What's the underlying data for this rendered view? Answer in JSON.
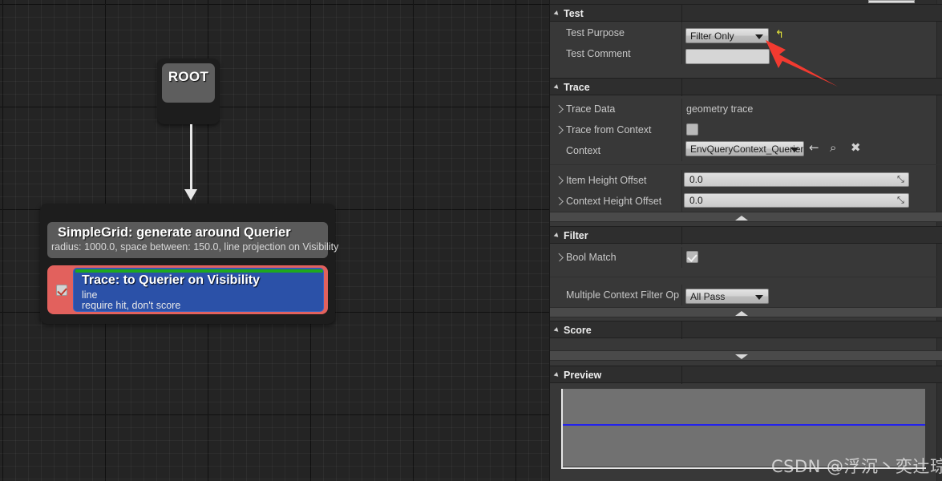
{
  "graph": {
    "root_node": {
      "label": "ROOT"
    },
    "generator_node": {
      "title": "SimpleGrid: generate around Querier",
      "subtitle": "radius: 1000.0, space between: 150.0, line projection on Visibility"
    },
    "test_node": {
      "title": "Trace: to Querier on Visibility",
      "line1": "line",
      "line2": "require hit, don't score",
      "enabled": true
    }
  },
  "details": {
    "sections": {
      "test": {
        "title": "Test",
        "rows": {
          "test_purpose": {
            "label": "Test Purpose",
            "value": "Filter Only"
          },
          "test_comment": {
            "label": "Test Comment",
            "value": ""
          }
        },
        "revert_icon": "↰"
      },
      "trace": {
        "title": "Trace",
        "rows": {
          "trace_data": {
            "label": "Trace Data",
            "value": "geometry trace"
          },
          "trace_from_context": {
            "label": "Trace from Context",
            "checked": false
          },
          "context": {
            "label": "Context",
            "value": "EnvQueryContext_Querier"
          },
          "item_height_offset": {
            "label": "Item Height Offset",
            "value": "0.0"
          },
          "context_height_offset": {
            "label": "Context Height Offset",
            "value": "0.0"
          }
        },
        "context_icons": {
          "back": "←",
          "browse": "⌕",
          "clear": "✖"
        }
      },
      "filter": {
        "title": "Filter",
        "rows": {
          "bool_match": {
            "label": "Bool Match",
            "checked": true
          },
          "multiple_context_filter_op": {
            "label": "Multiple Context Filter Op",
            "value": "All Pass"
          }
        }
      },
      "score": {
        "title": "Score"
      },
      "preview": {
        "title": "Preview"
      }
    }
  },
  "watermark": {
    "text": "CSDN @浮沉丶奕辻琮"
  }
}
